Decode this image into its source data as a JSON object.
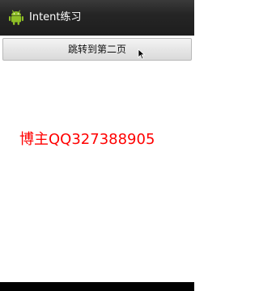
{
  "app": {
    "title": "Intent练习",
    "icon": "android-icon",
    "icon_color": "#8fbf26"
  },
  "main": {
    "jump_button_label": "跳转到第二页",
    "blogger_text": "博主QQ327388905",
    "blogger_text_color": "#ff0000"
  }
}
